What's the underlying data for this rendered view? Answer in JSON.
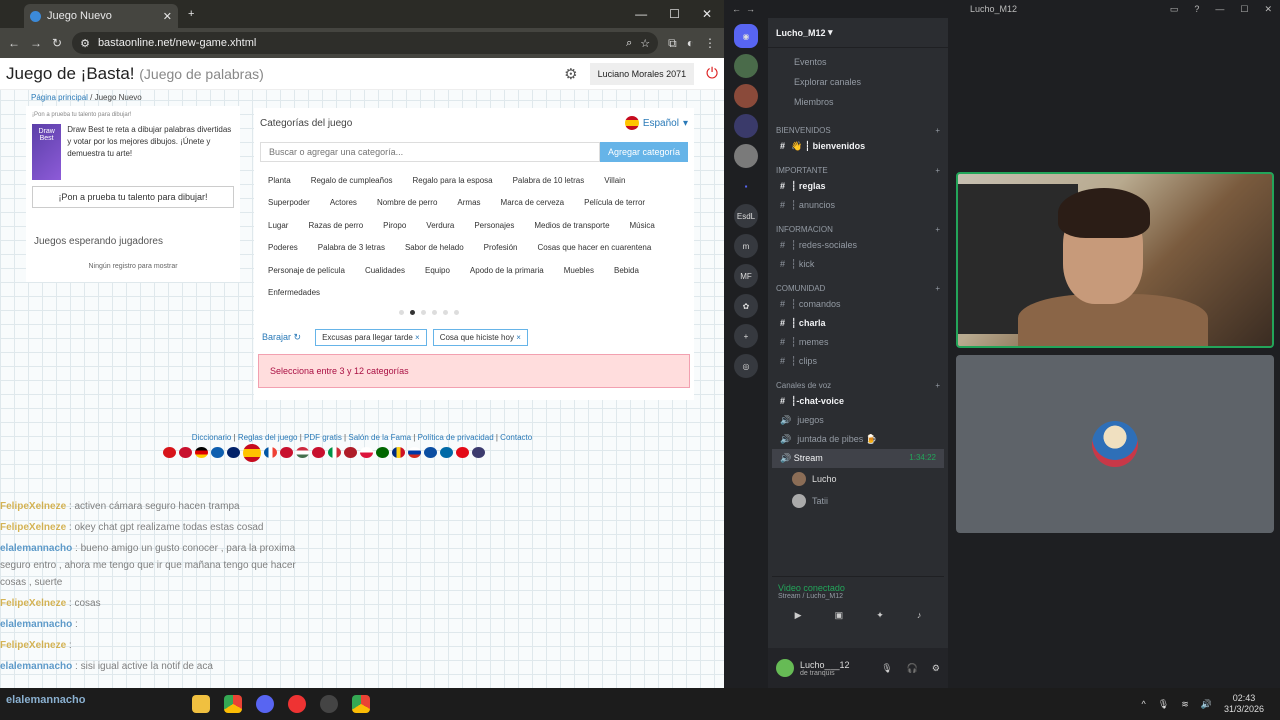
{
  "browser": {
    "tab_title": "Juego Nuevo",
    "url": "bastaonline.net/new-game.xhtml",
    "window_controls": [
      "—",
      "☐",
      "✕"
    ]
  },
  "site": {
    "title": "Juego de ¡Basta!",
    "subtitle": "(Juego de palabras)",
    "user_name": "Luciano Morales 2071",
    "breadcrumb_home": "Página principal",
    "breadcrumb_current": "Juego Nuevo"
  },
  "promo": {
    "small_title": "¡Pon a prueba tu talento para dibujar!",
    "thumb_label": "Draw Best",
    "description": "Draw Best te reta a dibujar palabras divertidas y votar por los mejores dibujos. ¡Únete y demuestra tu arte!",
    "button": "¡Pon a prueba tu talento para dibujar!"
  },
  "waiting": {
    "heading": "Juegos esperando jugadores",
    "empty": "Ningún registro para mostrar"
  },
  "categories": {
    "heading": "Categorías del juego",
    "language": "Español",
    "search_placeholder": "Buscar o agregar una categoría...",
    "add_button": "Agregar categoría",
    "items": [
      "Planta",
      "Regalo de cumpleaños",
      "Regalo para la esposa",
      "Palabra de 10 letras",
      "Villain",
      "Superpoder",
      "Actores",
      "Nombre de perro",
      "Armas",
      "Marca de cerveza",
      "Película de terror",
      "Lugar",
      "Razas de perro",
      "Piropo",
      "Verdura",
      "Personajes",
      "Medios de transporte",
      "Música",
      "Poderes",
      "Palabra de 3 letras",
      "Sabor de helado",
      "Profesión",
      "Cosas que hacer en cuarentena",
      "Personaje de película",
      "Cualidades",
      "Equipo",
      "Apodo de la primaria",
      "Muebles",
      "Bebida",
      "Enfermedades"
    ],
    "shuffle": "Barajar",
    "selected": [
      "Excusas para llegar tarde",
      "Cosa que hiciste hoy"
    ],
    "alert": "Selecciona entre 3 y 12 categorías"
  },
  "footer_links": [
    "Diccionario",
    "Reglas del juego",
    "PDF gratis",
    "Salón de la Fama",
    "Política de privacidad",
    "Contacto"
  ],
  "chat": [
    {
      "user": "FelipeXelneze",
      "text": ": activen cámara seguro hacen trampa",
      "cls": "u1"
    },
    {
      "user": "FelipeXelneze",
      "text": ": okey chat gpt realizame todas estas cosad",
      "cls": "u1"
    },
    {
      "user": "elalemannacho",
      "text": ": bueno amigo un gusto conocer , para la proxima seguro entro , ahora me tengo que ir que mañana tengo que hacer cosas , suerte",
      "cls": "u2"
    },
    {
      "user": "FelipeXelneze",
      "text": ": cosas",
      "cls": "u1"
    },
    {
      "user": "elalemannacho",
      "text": ":",
      "cls": "u2"
    },
    {
      "user": "FelipeXelneze",
      "text": ":",
      "cls": "u1"
    },
    {
      "user": "elalemannacho",
      "text": ": sisi igual active la notif de aca",
      "cls": "u2"
    }
  ],
  "discord": {
    "window_title": "Lucho_M12",
    "server_name": "Lucho_M12",
    "nav": [
      "Eventos",
      "Explorar canales",
      "Miembros"
    ],
    "rail": [
      "EsdL",
      "m",
      "MF"
    ],
    "sections": [
      {
        "name": "BIENVENIDOS",
        "channels": [
          {
            "name": "👋 ┆ bienvenidos",
            "bold": true
          }
        ]
      },
      {
        "name": "IMPORTANTE",
        "channels": [
          {
            "name": "┆ reglas",
            "bold": true
          },
          {
            "name": "┆ anuncios",
            "bold": false
          }
        ]
      },
      {
        "name": "INFORMACION",
        "channels": [
          {
            "name": "┆ redes-sociales",
            "bold": false
          },
          {
            "name": "┆ kick",
            "bold": false
          }
        ]
      },
      {
        "name": "COMUNIDAD",
        "channels": [
          {
            "name": "┆ comandos",
            "bold": false
          },
          {
            "name": "┆ charla",
            "bold": true
          },
          {
            "name": "┆ memes",
            "bold": false
          },
          {
            "name": "┆ clips",
            "bold": false
          }
        ]
      }
    ],
    "voice_category": "Canales de voz",
    "voice_channels": [
      "┆-chat-voice",
      "juegos",
      "juntada de pibes 🍺"
    ],
    "active_voice": "Stream",
    "active_time": "1:34:22",
    "voice_users": [
      "Lucho",
      "Tatii"
    ],
    "connection_status": "Video conectado",
    "connection_sub": "Stream / Lucho_M12",
    "self_name": "Lucho___12",
    "self_status": "de tranquis"
  },
  "taskbar": {
    "time": "02:43",
    "date": "31/3/2026",
    "ghost_text": "elalemannacho"
  }
}
